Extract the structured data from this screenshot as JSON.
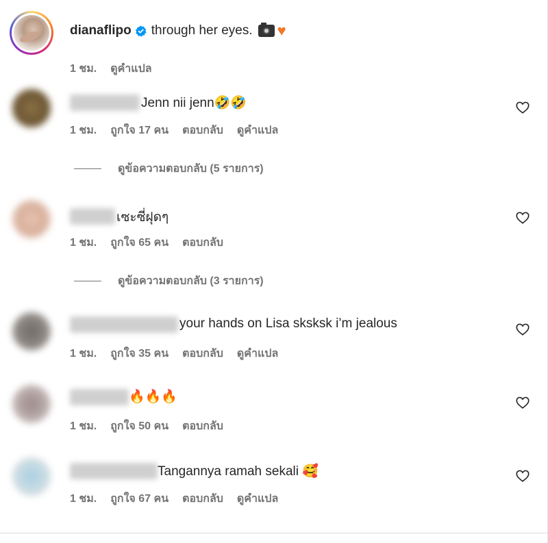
{
  "caption": {
    "username": "dianaflipo",
    "text": "through her eyes.",
    "emojis": [
      "camera",
      "orange-heart"
    ],
    "time": "1 ชม.",
    "translate": "ดูคำแปล"
  },
  "comments": [
    {
      "text": "Jenn nii jenn🤣🤣",
      "time": "1 ชม.",
      "likes": "ถูกใจ 17 คน",
      "reply": "ตอบกลับ",
      "translate": "ดูคำแปล",
      "replies": "ดูข้อความตอบกลับ (5 รายการ)"
    },
    {
      "text": "เซะซี่ฝุดๆ",
      "time": "1 ชม.",
      "likes": "ถูกใจ 65 คน",
      "reply": "ตอบกลับ",
      "replies": "ดูข้อความตอบกลับ (3 รายการ)"
    },
    {
      "text": "your hands on Lisa sksksk i’m jealous",
      "time": "1 ชม.",
      "likes": "ถูกใจ 35 คน",
      "reply": "ตอบกลับ",
      "translate": "ดูคำแปล"
    },
    {
      "text": "🔥🔥🔥",
      "time": "1 ชม.",
      "likes": "ถูกใจ 50 คน",
      "reply": "ตอบกลับ"
    },
    {
      "text": "Tangannya ramah sekali 🥰",
      "time": "1 ชม.",
      "likes": "ถูกใจ 67 คน",
      "reply": "ตอบกลับ",
      "translate": "ดูคำแปล"
    }
  ],
  "colors": {
    "text": "#262626",
    "secondary": "#737373",
    "verified": "#0095f6"
  }
}
